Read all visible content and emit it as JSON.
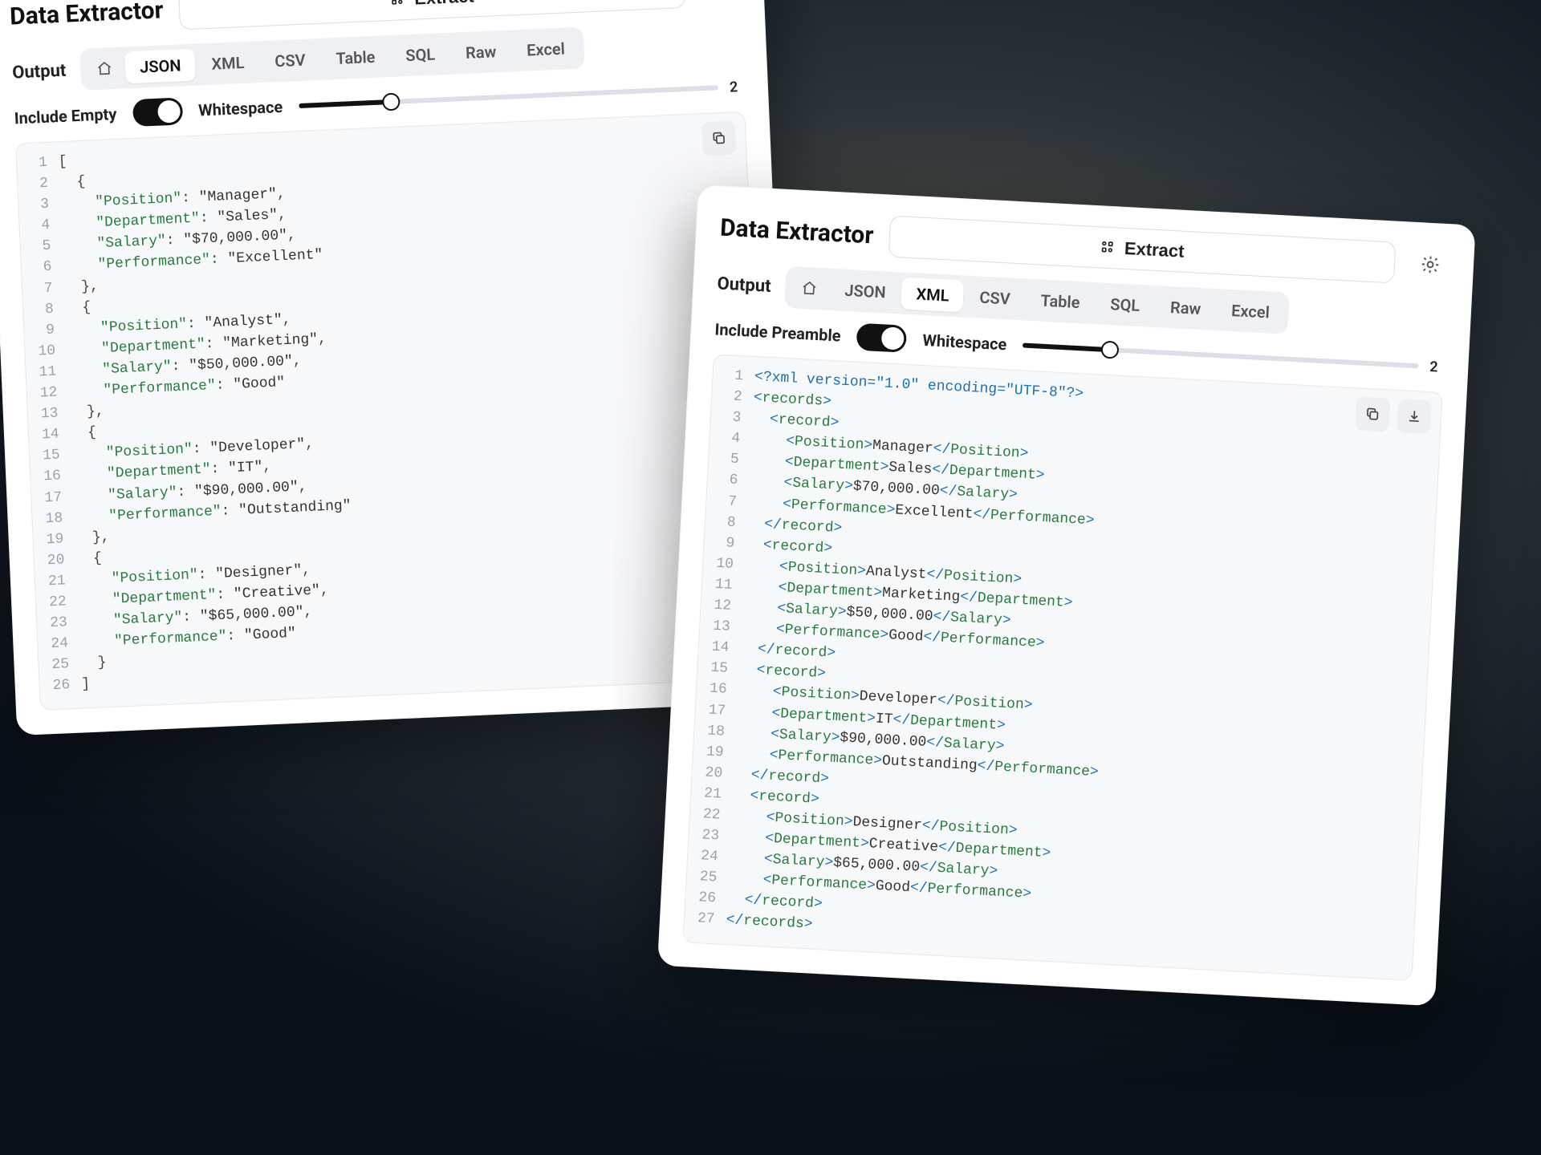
{
  "app_title": "Data Extractor",
  "extract_label": "Extract",
  "output_label": "Output",
  "tabs": [
    "JSON",
    "XML",
    "CSV",
    "Table",
    "SQL",
    "Raw",
    "Excel"
  ],
  "whitespace_label": "Whitespace",
  "whitespace_value": "2",
  "panel_json": {
    "active_tab": "JSON",
    "toggle_label": "Include Empty",
    "code": [
      "[",
      "  {",
      "    \"Position\": \"Manager\",",
      "    \"Department\": \"Sales\",",
      "    \"Salary\": \"$70,000.00\",",
      "    \"Performance\": \"Excellent\"",
      "  },",
      "  {",
      "    \"Position\": \"Analyst\",",
      "    \"Department\": \"Marketing\",",
      "    \"Salary\": \"$50,000.00\",",
      "    \"Performance\": \"Good\"",
      "  },",
      "  {",
      "    \"Position\": \"Developer\",",
      "    \"Department\": \"IT\",",
      "    \"Salary\": \"$90,000.00\",",
      "    \"Performance\": \"Outstanding\"",
      "  },",
      "  {",
      "    \"Position\": \"Designer\",",
      "    \"Department\": \"Creative\",",
      "    \"Salary\": \"$65,000.00\",",
      "    \"Performance\": \"Good\"",
      "  }",
      "]"
    ]
  },
  "panel_xml": {
    "active_tab": "XML",
    "toggle_label": "Include Preamble",
    "code": [
      "<?xml version=\"1.0\" encoding=\"UTF-8\"?>",
      "<records>",
      "  <record>",
      "    <Position>Manager</Position>",
      "    <Department>Sales</Department>",
      "    <Salary>$70,000.00</Salary>",
      "    <Performance>Excellent</Performance>",
      "  </record>",
      "  <record>",
      "    <Position>Analyst</Position>",
      "    <Department>Marketing</Department>",
      "    <Salary>$50,000.00</Salary>",
      "    <Performance>Good</Performance>",
      "  </record>",
      "  <record>",
      "    <Position>Developer</Position>",
      "    <Department>IT</Department>",
      "    <Salary>$90,000.00</Salary>",
      "    <Performance>Outstanding</Performance>",
      "  </record>",
      "  <record>",
      "    <Position>Designer</Position>",
      "    <Department>Creative</Department>",
      "    <Salary>$65,000.00</Salary>",
      "    <Performance>Good</Performance>",
      "  </record>",
      "</records>"
    ]
  }
}
